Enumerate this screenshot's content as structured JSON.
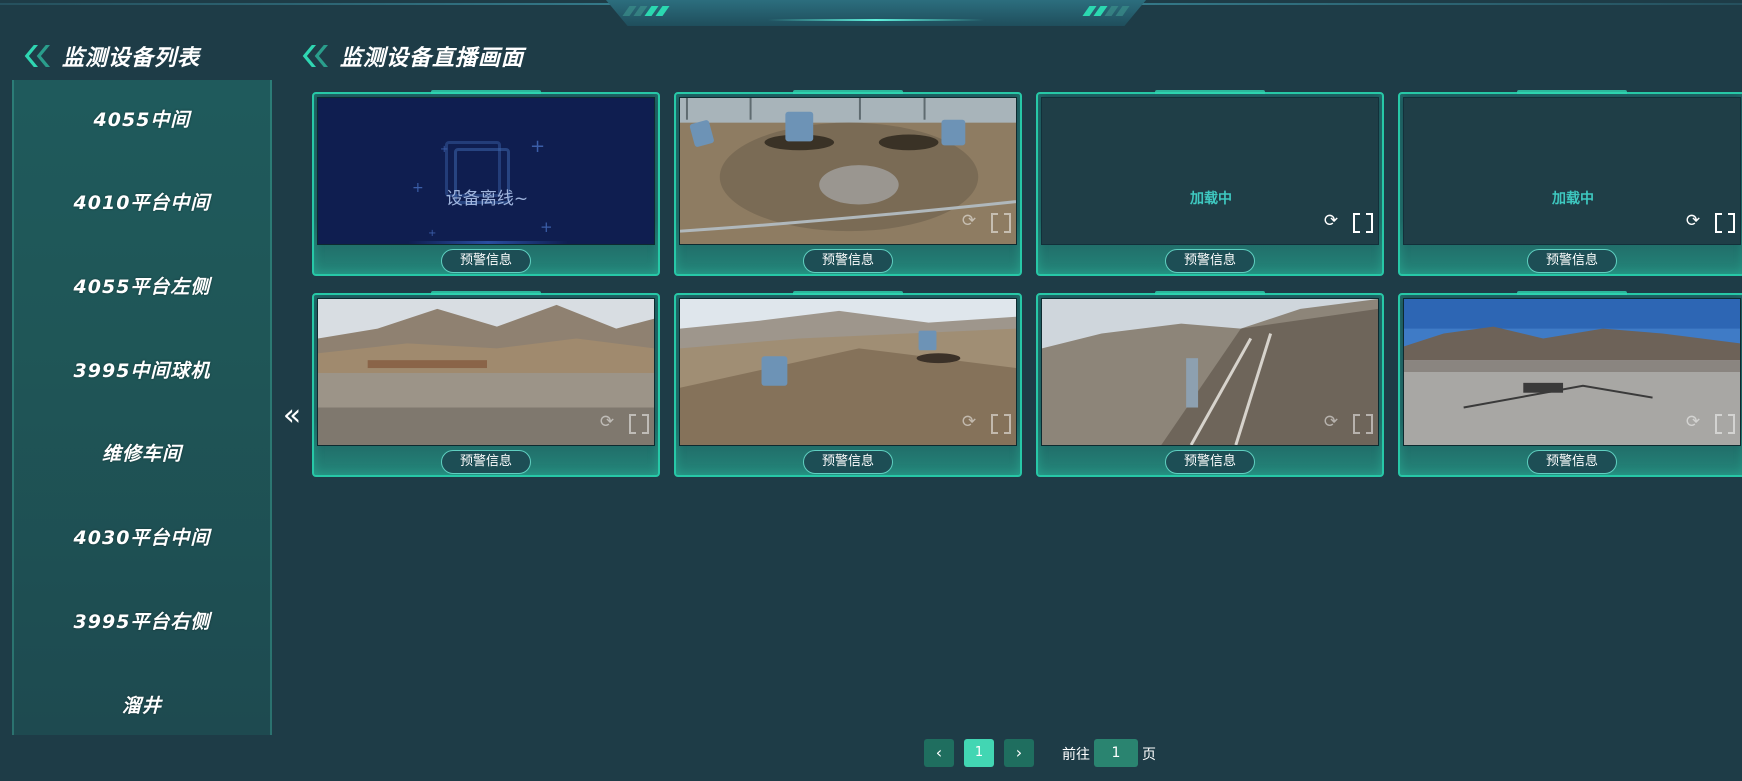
{
  "sidebar": {
    "title": "监测设备列表",
    "items": [
      {
        "label": "4055中间"
      },
      {
        "label": "4010平台中间"
      },
      {
        "label": "4055平台左侧"
      },
      {
        "label": "3995中间球机"
      },
      {
        "label": "维修车间"
      },
      {
        "label": "4030平台中间"
      },
      {
        "label": "3995平台右侧"
      },
      {
        "label": "溜井"
      }
    ],
    "collapse_glyph": "«"
  },
  "main": {
    "title": "监测设备直播画面",
    "cards": [
      {
        "state": "offline",
        "status_text": "设备离线~",
        "warn_label": "预警信息"
      },
      {
        "state": "live",
        "scene": "ground",
        "warn_label": "预警信息"
      },
      {
        "state": "loading",
        "status_text": "加载中",
        "warn_label": "预警信息"
      },
      {
        "state": "loading",
        "status_text": "加载中",
        "warn_label": "预警信息"
      },
      {
        "state": "live",
        "scene": "valley",
        "warn_label": "预警信息"
      },
      {
        "state": "live",
        "scene": "slope",
        "warn_label": "预警信息"
      },
      {
        "state": "live",
        "scene": "embankment",
        "warn_label": "预警信息"
      },
      {
        "state": "live",
        "scene": "plain",
        "warn_label": "预警信息"
      }
    ],
    "icons": {
      "refresh": "refresh-icon",
      "fullscreen": "fullscreen-icon"
    }
  },
  "pagination": {
    "prev": "‹",
    "current_page": "1",
    "next": "›",
    "goto_prefix": "前往",
    "goto_value": "1",
    "goto_suffix": "页"
  },
  "colors": {
    "background": "#1e3c47",
    "accent": "#2fd6b2",
    "offline_bg": "#0f1e50"
  }
}
